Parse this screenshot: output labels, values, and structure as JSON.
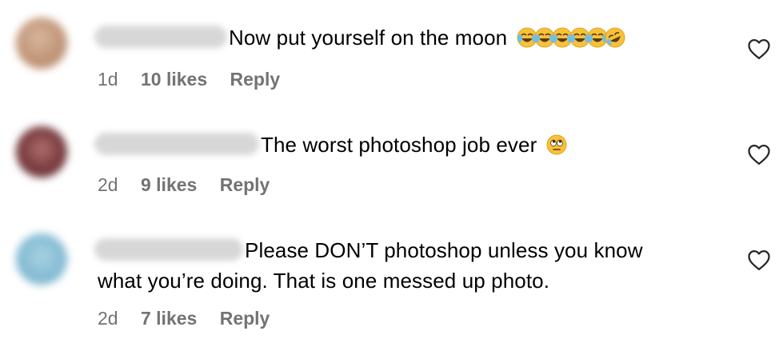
{
  "comments": [
    {
      "time": "1d",
      "likes": "10 likes",
      "reply": "Reply",
      "text": "Now put yourself on the moon",
      "emoji": "😂😂😂😂😂🤣",
      "avatar_color": "#c9a58b"
    },
    {
      "time": "2d",
      "likes": "9 likes",
      "reply": "Reply",
      "text": "The worst photoshop job ever",
      "emoji": "🙄",
      "avatar_color": "#8a4a4c"
    },
    {
      "time": "2d",
      "likes": "7 likes",
      "reply": "Reply",
      "text_line1": "Please DON’T photoshop unless you know",
      "text_line2": "what you’re doing. That is one messed up photo.",
      "avatar_color": "#8cc0d6"
    }
  ],
  "icons": {
    "like": "heart-outline-icon",
    "laughing": "face-with-tears-of-joy-icon",
    "rofl": "rolling-on-the-floor-laughing-icon",
    "eye_roll": "face-with-rolling-eyes-icon"
  },
  "colors": {
    "meta_text": "#737373",
    "body_text": "#000000",
    "emoji_yellow": "#f7c23a"
  }
}
